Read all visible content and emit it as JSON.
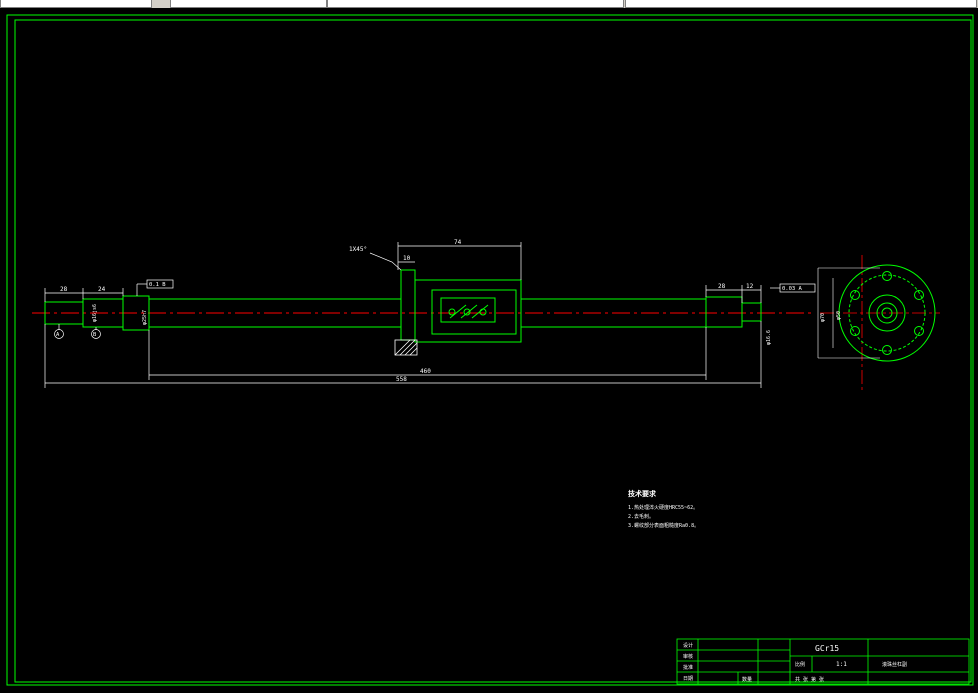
{
  "drawing": {
    "title_dims": {
      "d_left1": "28",
      "d_left2": "24",
      "d_total": "558",
      "d_mid": "460",
      "d_nut": "74",
      "d_flange": "10",
      "d_right1": "28",
      "d_right2": "12",
      "chamfer": "1X45°",
      "tol_frame_left": "0.1 B",
      "tol_frame_right": "0.03 A",
      "datum_a": "A",
      "datum_b": "B",
      "dia_left": "φ16js6",
      "dia_mid": "φ25h7",
      "dia_right": "φ16.6",
      "dia_flange_outer": "φ70",
      "dia_flange_inner": "φ50"
    },
    "notes": {
      "heading": "技术要求",
      "lines": [
        "1.热处理淬火硬度HRC55~62。",
        "2.去毛刺。",
        "3.螺纹部分表面粗糙度Ra0.8。"
      ]
    },
    "title_block": {
      "material": "GCr15",
      "scale_label": "比例",
      "scale": "1:1",
      "part_name": "滚珠丝杠副",
      "row_labels": [
        "设计",
        "审核",
        "批准",
        "日期"
      ],
      "sheet": "共 张 第 张",
      "qty_label": "数量"
    }
  },
  "colors": {
    "frame": "#00ff00",
    "outline": "#00ff00",
    "dims": "#ffffff",
    "center": "#ff0000",
    "hatch": "#ffffff",
    "titlebox": "#00ff00"
  }
}
